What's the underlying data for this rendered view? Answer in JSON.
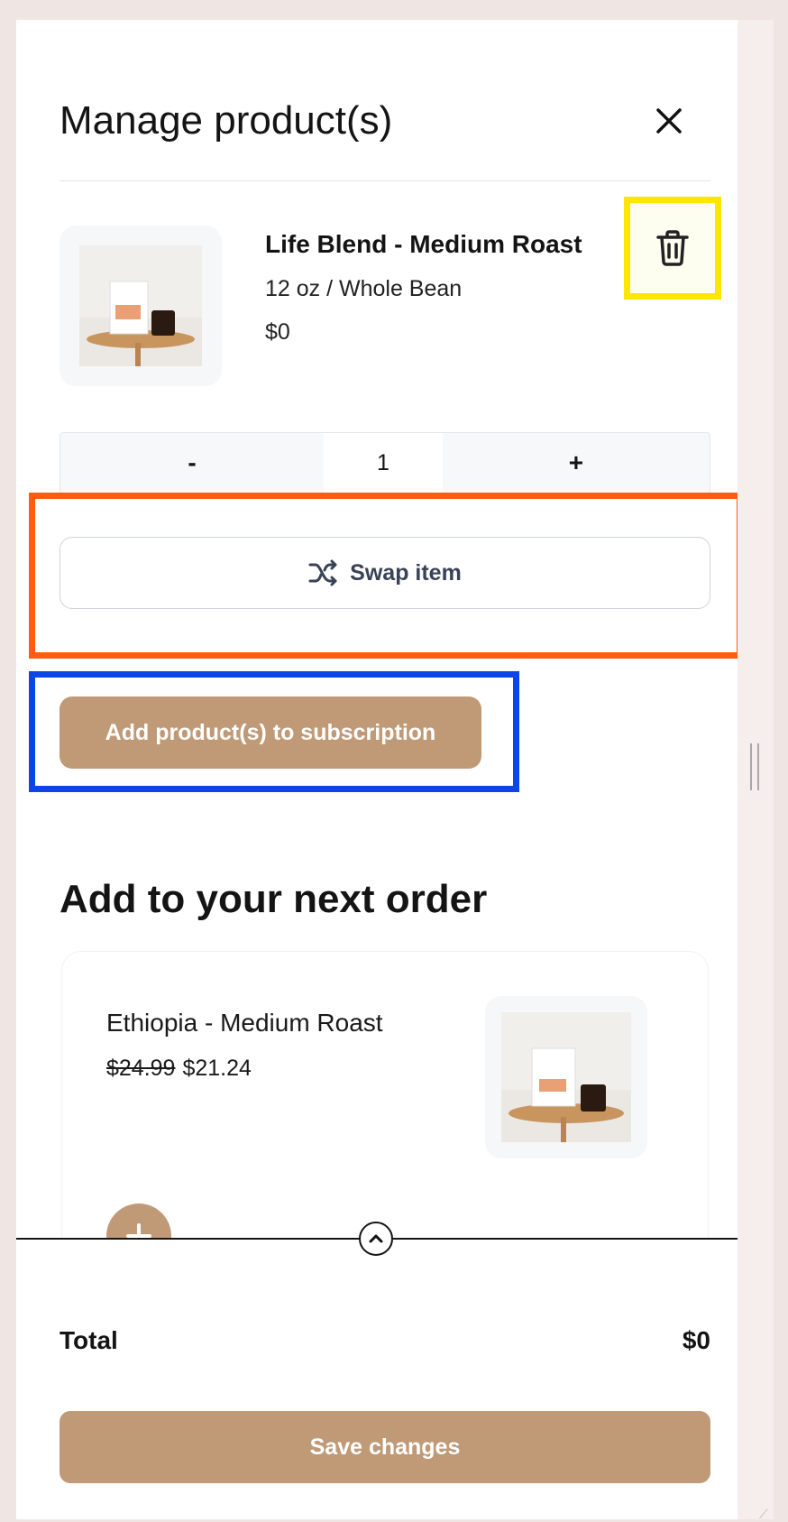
{
  "header": {
    "title": "Manage product(s)",
    "close_icon": "close-icon"
  },
  "product": {
    "name": "Life Blend - Medium Roast",
    "variant": "12 oz / Whole Bean",
    "price": "$0",
    "image_icon": "product-image",
    "delete_icon": "trash-icon"
  },
  "quantity": {
    "minus_label": "-",
    "value": "1",
    "plus_label": "+"
  },
  "actions": {
    "swap_label": "Swap item",
    "swap_icon": "shuffle-icon",
    "add_label": "Add product(s) to subscription"
  },
  "upsell": {
    "section_title": "Add to your next order",
    "items": [
      {
        "name": "Ethiopia - Medium Roast",
        "old_price": "$24.99",
        "price": "$21.24",
        "image_icon": "product-image",
        "add_icon": "plus-icon"
      }
    ]
  },
  "footer": {
    "toggle_icon": "chevron-up-icon",
    "total_label": "Total",
    "total_value": "$0",
    "save_label": "Save changes"
  },
  "colors": {
    "accent": "#c09a76",
    "highlight_yellow": "#ffe600",
    "highlight_orange": "#ff5c0f",
    "highlight_blue": "#0b47e8"
  }
}
